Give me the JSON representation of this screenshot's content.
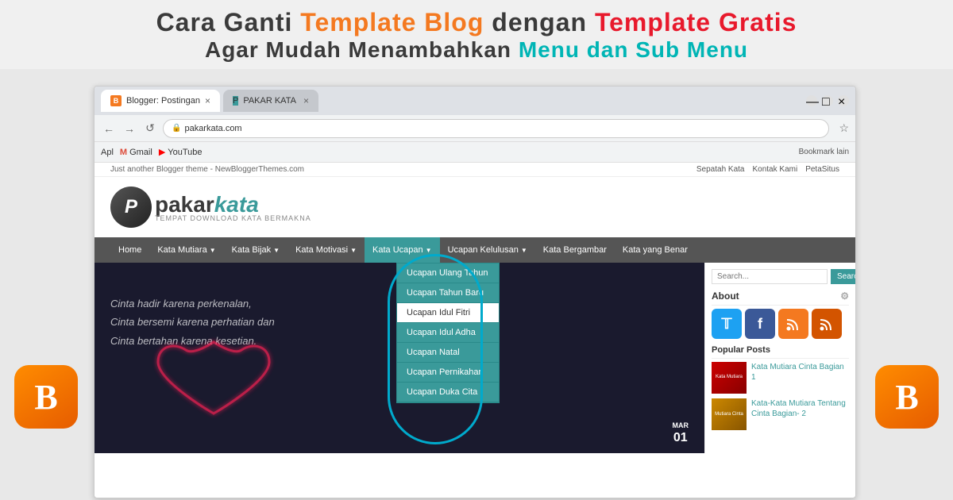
{
  "title_line1": {
    "part1": "Cara Ganti ",
    "orange_text": "Template Blog",
    "part2": " dengan ",
    "red_text": "Template Gratis"
  },
  "title_line2": {
    "part1": "Agar Mudah Menambahkan ",
    "teal_text": "Menu dan Sub Menu"
  },
  "browser": {
    "tab1_label": "Blogger: Postingan",
    "tab2_label": "PAKAR KATA",
    "address_url": "pakarkata.com",
    "bookmark_items": [
      "Apl",
      "Gmail",
      "YouTube"
    ],
    "bookmark_right": "Bookmark lain"
  },
  "blog": {
    "topbar_text": "Just another Blogger theme - NewBloggerThemes.com",
    "topbar_links": [
      "Sepatah Kata",
      "Kontak Kami",
      "PetaSitus"
    ],
    "logo_subtitle": "TEMPAT DOWNLOAD KATA BERMAKNA",
    "nav_items": [
      "Home",
      "Kata Mutiara",
      "Kata Bijak",
      "Kata Motivasi",
      "Kata Ucapan",
      "Ucapan Kelulusan",
      "Kata Bergambar",
      "Kata yang Benar"
    ],
    "dropdown_items": [
      "Ucapan Ulang Tahun",
      "Ucapan Tahun Baru",
      "Ucapan Idul Fitri",
      "Ucapan Idul Adha",
      "Ucapan Natal",
      "Ucapan Pernikahan",
      "Ucapan Duka Cita"
    ],
    "post_text_line1": "Cinta hadir karena perkenalan,",
    "post_text_line2": "Cinta bersemi karena perhatian dan",
    "post_text_line3": "Cinta bertahan karena kesetian.",
    "search_placeholder": "Search...",
    "search_btn": "Search",
    "sidebar_about_title": "About",
    "sidebar_popular_title": "Popular Posts",
    "popular_post1": "Kata Mutiara Cinta Bagian 1",
    "popular_post2": "Kata-Kata Mutiara Tentang Cinta Bagian- 2",
    "mar_month": "MAR",
    "mar_day": "01"
  },
  "blogger_b": "B"
}
